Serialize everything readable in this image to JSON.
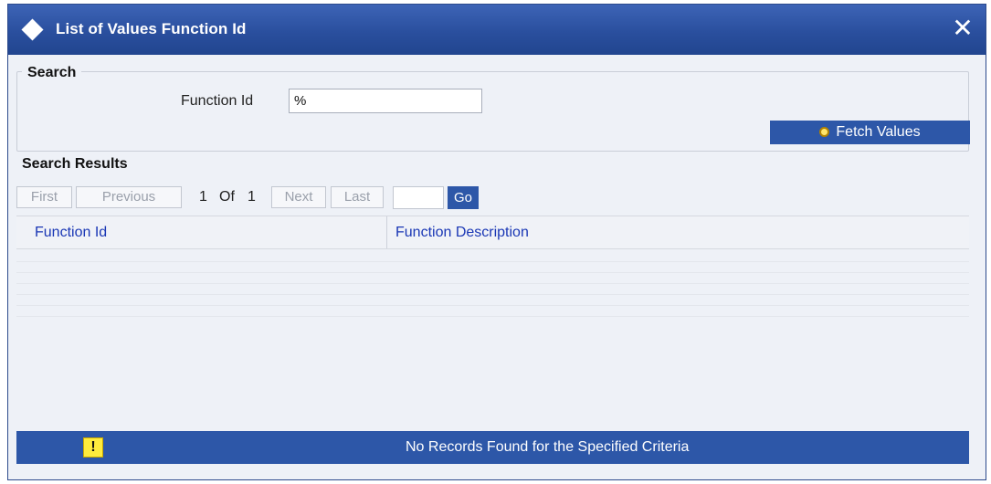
{
  "window": {
    "title": "List of Values Function Id",
    "close_label": "✕"
  },
  "search": {
    "legend": "Search",
    "function_id_label": "Function Id",
    "function_id_value": "%",
    "fetch_label": "Fetch Values"
  },
  "results": {
    "title": "Search Results",
    "pager": {
      "first": "First",
      "previous": "Previous",
      "current_page": "1",
      "of_label": "Of",
      "total_pages": "1",
      "next": "Next",
      "last": "Last",
      "go": "Go"
    },
    "columns": [
      "Function Id",
      "Function Description"
    ]
  },
  "status": {
    "icon": "warning-icon",
    "icon_glyph": "!",
    "message": "No Records Found for the Specified Criteria"
  },
  "colors": {
    "title_bar": "#2a4f9e",
    "button_bg": "#2d57a8",
    "column_header_text": "#1a37b5",
    "warning_icon": "#ffec3d"
  }
}
